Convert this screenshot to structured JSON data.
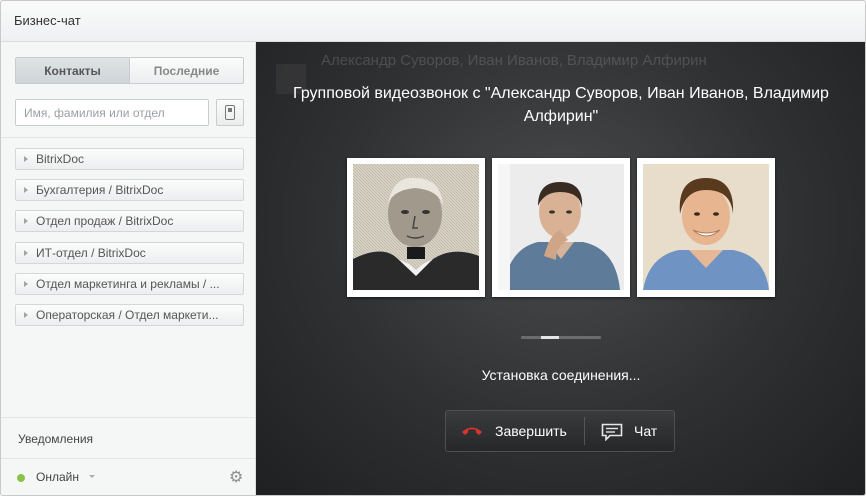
{
  "window": {
    "title": "Бизнес-чат"
  },
  "sidebar": {
    "tabs": [
      {
        "label": "Контакты",
        "active": true
      },
      {
        "label": "Последние",
        "active": false
      }
    ],
    "search": {
      "placeholder": "Имя, фамилия или отдел",
      "value": ""
    },
    "phone_icon": "mobile-phone-icon",
    "groups": [
      "BitrixDoc",
      "Бухгалтерия / BitrixDoc",
      "Отдел продаж / BitrixDoc",
      "ИТ-отдел / BitrixDoc",
      "Отдел маркетинга и рекламы / ...",
      "Операторская / Отдел маркети..."
    ],
    "notifications_label": "Уведомления",
    "status": {
      "label": "Онлайн",
      "color": "#8bc34a"
    },
    "settings_icon": "gear-icon"
  },
  "call": {
    "background_title": "Александр Суворов, Иван Иванов, Владимир Алфирин",
    "title": "Групповой видеозвонок с \"Александр Суворов, Иван Иванов, Владимир Алфирин\"",
    "participants": [
      "Александр Суворов",
      "Иван Иванов",
      "Владимир Алфирин"
    ],
    "status_text": "Установка соединения...",
    "end_button": {
      "label": "Завершить",
      "icon": "hangup-phone-icon",
      "icon_color": "#d9342b"
    },
    "chat_button": {
      "label": "Чат",
      "icon": "chat-bubble-icon"
    }
  }
}
